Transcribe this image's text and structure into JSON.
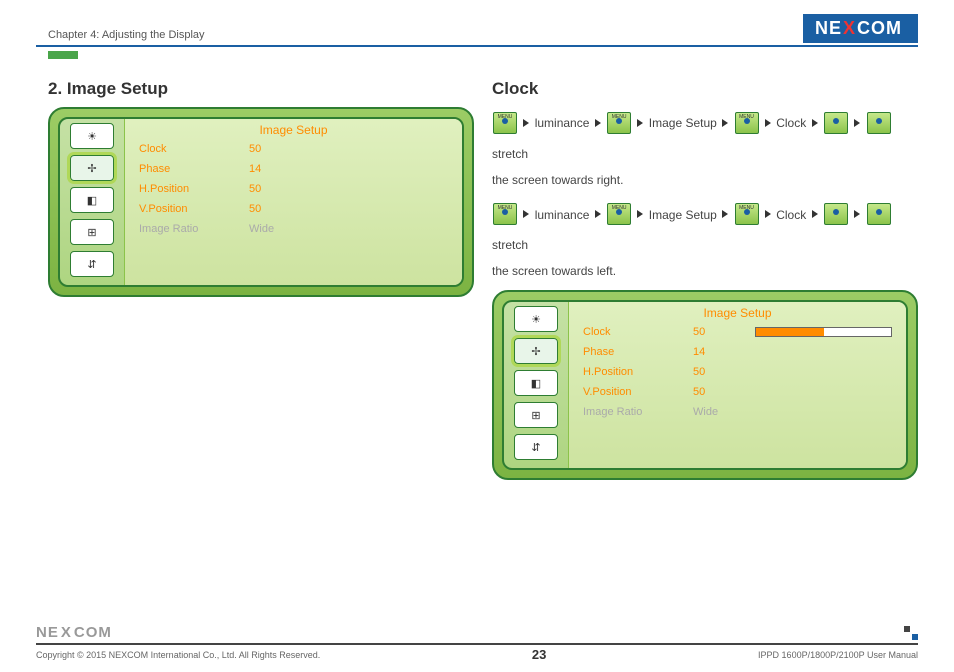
{
  "header": {
    "chapter": "Chapter 4: Adjusting the Display",
    "brand": "NE COM",
    "brand_parts": {
      "a": "NE",
      "x": "X",
      "b": "COM"
    }
  },
  "section_left": {
    "title": "2. Image Setup",
    "osd": {
      "title": "Image Setup",
      "rows": [
        {
          "label": "Clock",
          "value": "50",
          "style": "orange"
        },
        {
          "label": "Phase",
          "value": "14",
          "style": "orange"
        },
        {
          "label": "H.Position",
          "value": "50",
          "style": "orange"
        },
        {
          "label": "V.Position",
          "value": "50",
          "style": "orange"
        },
        {
          "label": "Image Ratio",
          "value": "Wide",
          "style": "dim"
        }
      ]
    }
  },
  "section_right": {
    "title": "Clock",
    "nav_labels": {
      "luminance": "luminance",
      "image_setup": "Image Setup",
      "clock": "Clock",
      "stretch": "stretch",
      "menu": "MENU"
    },
    "desc1": "the screen towards right.",
    "desc2": "the screen towards left.",
    "osd": {
      "title": "Image Setup",
      "rows": [
        {
          "label": "Clock",
          "value": "50",
          "style": "orange",
          "bar": 50
        },
        {
          "label": "Phase",
          "value": "14",
          "style": "orange"
        },
        {
          "label": "H.Position",
          "value": "50",
          "style": "orange"
        },
        {
          "label": "V.Position",
          "value": "50",
          "style": "orange"
        },
        {
          "label": "Image Ratio",
          "value": "Wide",
          "style": "dim"
        }
      ]
    }
  },
  "footer": {
    "brand_parts": {
      "a": "NE",
      "x": "X",
      "b": "COM"
    },
    "copyright": "Copyright © 2015 NEXCOM International Co., Ltd. All Rights Reserved.",
    "page": "23",
    "manual": "IPPD 1600P/1800P/2100P User Manual"
  }
}
